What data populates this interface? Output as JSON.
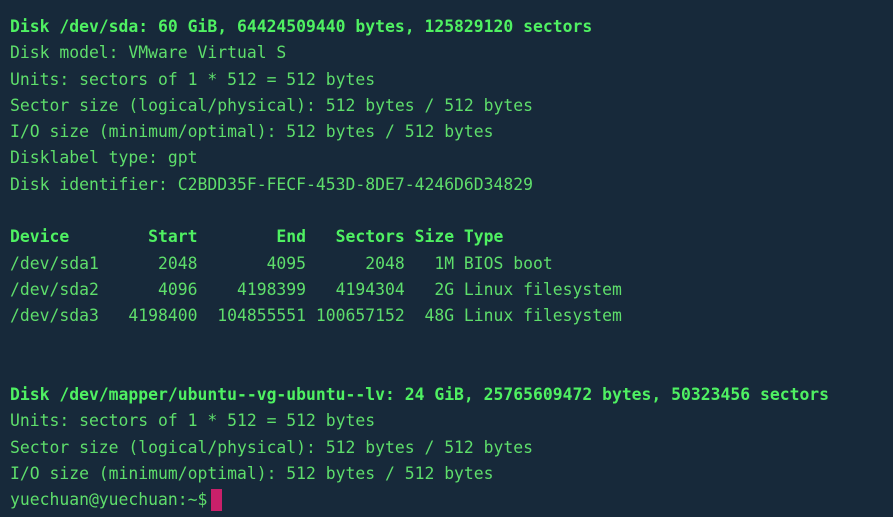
{
  "terminal": {
    "background_color": "#17293a",
    "text_color": "#5ede6b",
    "bold_text_color": "#4ff162",
    "cursor_color": "#c9206a"
  },
  "disk1": {
    "header": "Disk /dev/sda: 60 GiB, 64424509440 bytes, 125829120 sectors",
    "model": "Disk model: VMware Virtual S",
    "units": "Units: sectors of 1 * 512 = 512 bytes",
    "sector_size": "Sector size (logical/physical): 512 bytes / 512 bytes",
    "io_size": "I/O size (minimum/optimal): 512 bytes / 512 bytes",
    "disklabel": "Disklabel type: gpt",
    "identifier": "Disk identifier: C2BDD35F-FECF-453D-8DE7-4246D6D34829"
  },
  "partition_table": {
    "header": "Device        Start        End   Sectors Size Type",
    "rows": [
      "/dev/sda1      2048       4095      2048   1M BIOS boot",
      "/dev/sda2      4096    4198399   4194304   2G Linux filesystem",
      "/dev/sda3   4198400  104855551 100657152  48G Linux filesystem"
    ]
  },
  "disk2": {
    "header": "Disk /dev/mapper/ubuntu--vg-ubuntu--lv: 24 GiB, 25765609472 bytes, 50323456 sectors",
    "units": "Units: sectors of 1 * 512 = 512 bytes",
    "sector_size": "Sector size (logical/physical): 512 bytes / 512 bytes",
    "io_size": "I/O size (minimum/optimal): 512 bytes / 512 bytes"
  },
  "prompt": {
    "text": "yuechuan@yuechuan:~$",
    "cursor": ""
  },
  "blank": " "
}
